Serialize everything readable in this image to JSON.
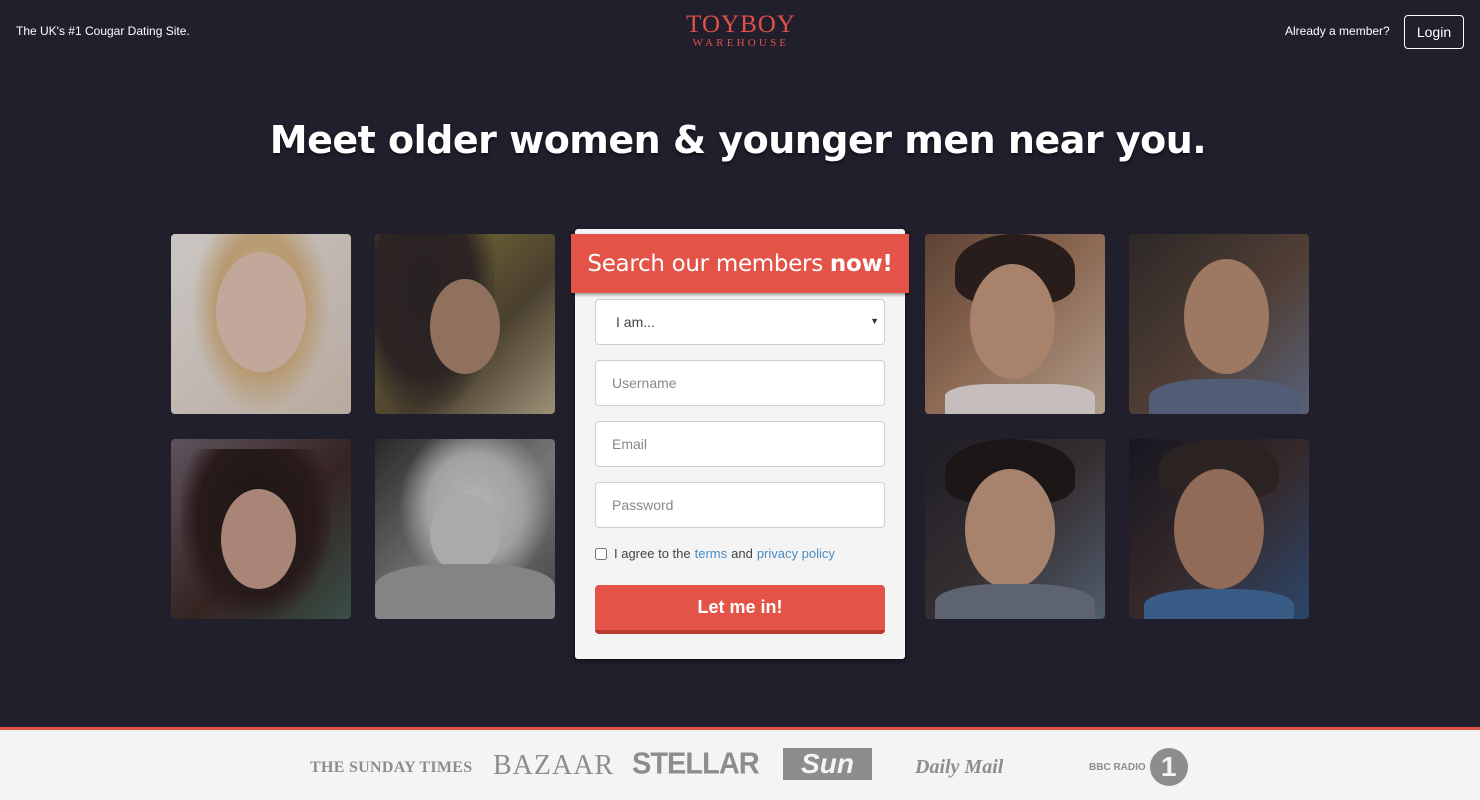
{
  "header": {
    "tagline": "The UK's #1 Cougar Dating Site.",
    "logo_top": "TOYBOY",
    "logo_bottom": "WAREHOUSE",
    "member_question": "Already a member?",
    "login_label": "Login"
  },
  "hero": {
    "headline_regular": "Meet older women & younger men",
    "headline_bold": "near you."
  },
  "form": {
    "title_regular": "Search our members",
    "title_bold": "now!",
    "select_value": "I am...",
    "username_placeholder": "Username",
    "email_placeholder": "Email",
    "password_placeholder": "Password",
    "agree_prefix": "I agree to the",
    "terms_link": "terms",
    "agree_and": "and",
    "privacy_link": "privacy policy",
    "submit_label": "Let me in!"
  },
  "press": {
    "logos": [
      "THE SUNDAY TIMES",
      "BAZAAR",
      "STELLAR",
      "Sun",
      "Daily Mail",
      "BBC RADIO",
      "1"
    ]
  },
  "colors": {
    "background": "#221f2d",
    "accent": "#e35347",
    "link": "#4a8cc4"
  }
}
